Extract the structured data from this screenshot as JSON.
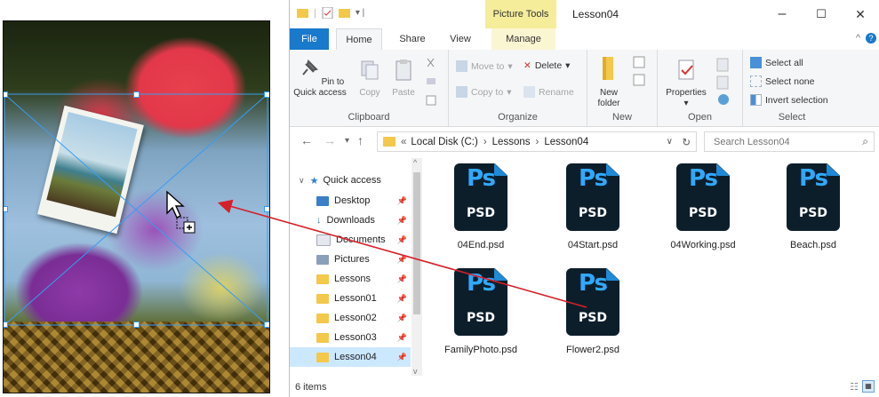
{
  "window": {
    "context_tab": "Picture Tools",
    "title": "Lesson04",
    "controls": {
      "minimize": "–",
      "maximize": "☐",
      "close": "✕"
    }
  },
  "tabs": {
    "file": "File",
    "home": "Home",
    "share": "Share",
    "view": "View",
    "manage": "Manage"
  },
  "ribbon": {
    "clipboard": {
      "label": "Clipboard",
      "pin": "Pin to Quick access",
      "copy": "Copy",
      "paste": "Paste"
    },
    "organize": {
      "label": "Organize",
      "move_to": "Move to",
      "copy_to": "Copy to",
      "delete": "Delete",
      "rename": "Rename"
    },
    "new": {
      "label": "New",
      "new_folder": "New folder"
    },
    "open": {
      "label": "Open",
      "properties": "Properties"
    },
    "select": {
      "label": "Select",
      "select_all": "Select all",
      "select_none": "Select none",
      "invert": "Invert selection"
    }
  },
  "address": {
    "prefix": "«",
    "crumbs": [
      "Local Disk (C:)",
      "Lessons",
      "Lesson04"
    ],
    "separator": "›",
    "search_placeholder": "Search Lesson04"
  },
  "nav": {
    "quick_access": "Quick access",
    "items": [
      {
        "label": "Desktop",
        "icon": "desktop-icon"
      },
      {
        "label": "Downloads",
        "icon": "download-icon"
      },
      {
        "label": "Documents",
        "icon": "documents-icon"
      },
      {
        "label": "Pictures",
        "icon": "pictures-icon"
      },
      {
        "label": "Lessons",
        "icon": "folder-icon"
      },
      {
        "label": "Lesson01",
        "icon": "folder-icon"
      },
      {
        "label": "Lesson02",
        "icon": "folder-icon"
      },
      {
        "label": "Lesson03",
        "icon": "folder-icon"
      },
      {
        "label": "Lesson04",
        "icon": "folder-icon",
        "selected": true
      }
    ]
  },
  "files": [
    {
      "name": "04End.psd",
      "type": "PSD",
      "badge": "Ps"
    },
    {
      "name": "04Start.psd",
      "type": "PSD",
      "badge": "Ps"
    },
    {
      "name": "04Working.psd",
      "type": "PSD",
      "badge": "Ps"
    },
    {
      "name": "Beach.psd",
      "type": "PSD",
      "badge": "Ps"
    },
    {
      "name": "FamilyPhoto.psd",
      "type": "PSD",
      "badge": "Ps"
    },
    {
      "name": "Flower2.psd",
      "type": "PSD",
      "badge": "Ps"
    }
  ],
  "status": {
    "count": "6 items"
  },
  "colors": {
    "accent": "#1979ca",
    "context_tab": "#f6ed9a",
    "selection": "#cce8ff",
    "ps_blue": "#31a8ff",
    "drag_arrow": "#d4202a"
  }
}
